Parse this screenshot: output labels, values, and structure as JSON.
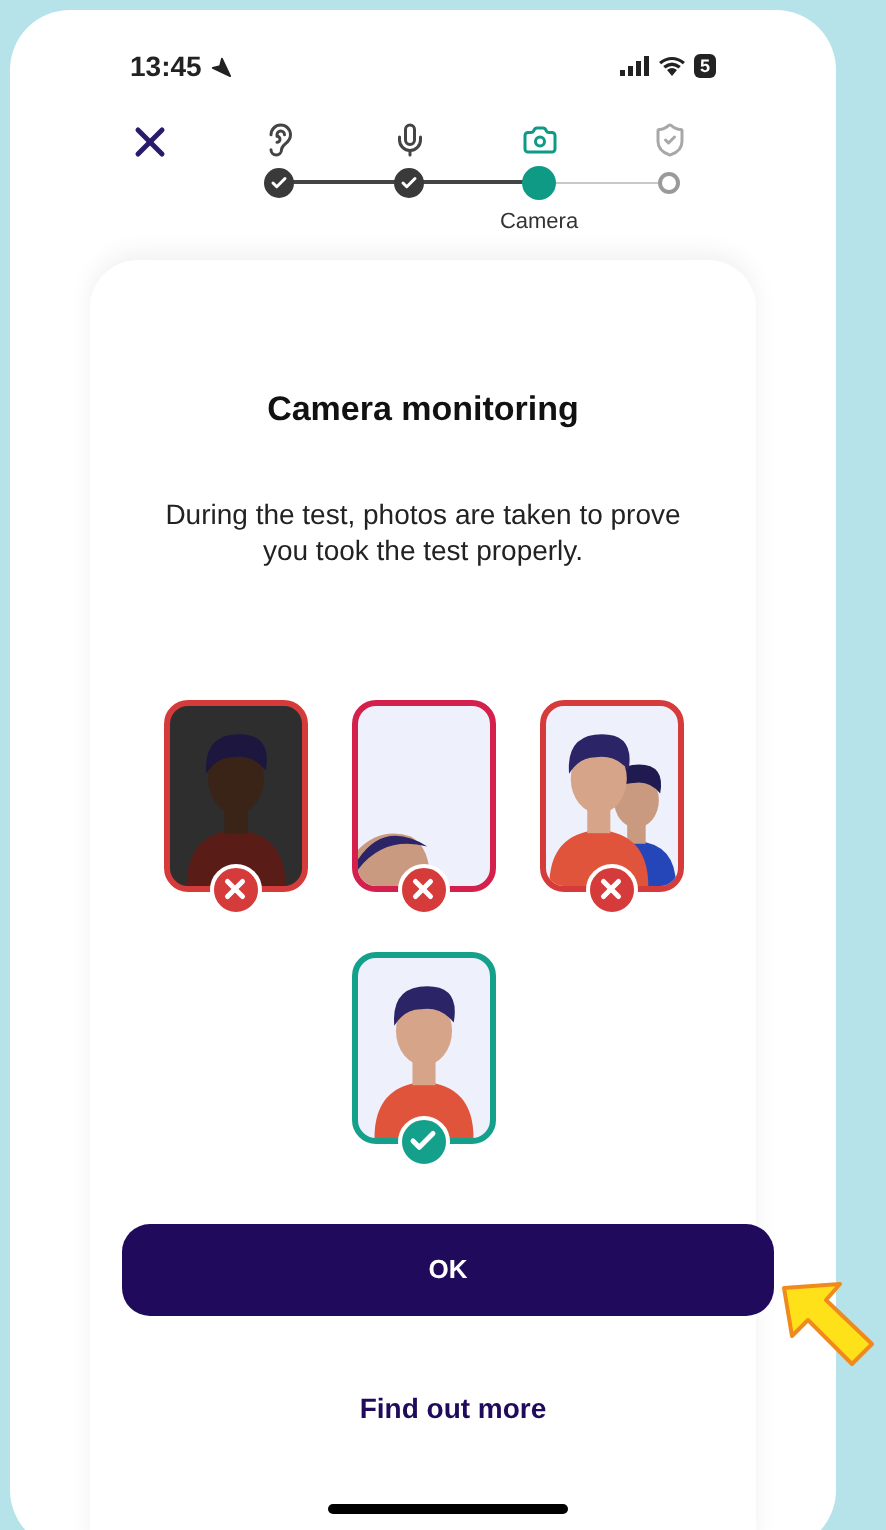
{
  "status_bar": {
    "time": "13:45",
    "battery": "5"
  },
  "steps": [
    {
      "kind": "ear",
      "completed": true,
      "selected": false
    },
    {
      "kind": "mic",
      "completed": true,
      "selected": false
    },
    {
      "kind": "camera",
      "completed": false,
      "selected": true,
      "label": "Camera"
    },
    {
      "kind": "shield",
      "completed": false,
      "selected": false
    }
  ],
  "title": "Camera monitoring",
  "description": "During the test, photos are taken to prove you took the test properly.",
  "photos": [
    {
      "kind": "dark",
      "accepted": false
    },
    {
      "kind": "cropped",
      "accepted": false
    },
    {
      "kind": "group",
      "accepted": false
    },
    {
      "kind": "centered",
      "accepted": true
    }
  ],
  "primary_button": "OK",
  "link": "Find out more"
}
